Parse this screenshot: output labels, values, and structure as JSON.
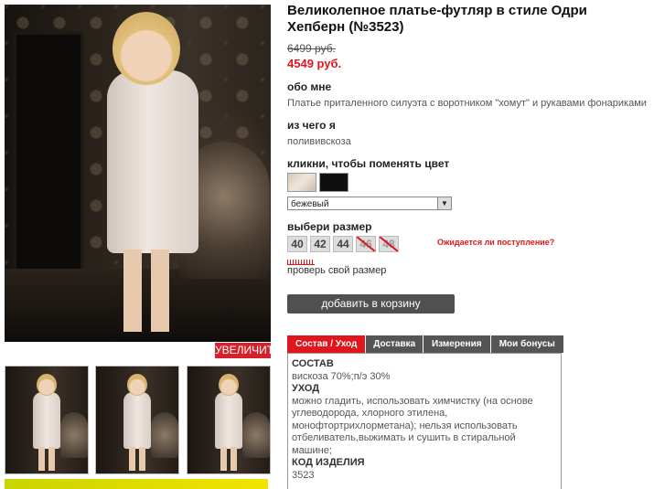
{
  "product": {
    "title": "Великолепное платье-футляр в стиле Одри Хепберн (№3523)",
    "old_price": "6499 руб.",
    "new_price": "4549 руб."
  },
  "gallery": {
    "zoom_label": "УВЕЛИЧИТЬ",
    "thumbnails": [
      "photo-1",
      "photo-2",
      "photo-3"
    ]
  },
  "about": {
    "heading": "обо мне",
    "text": "Платье приталенного силуэта с воротником \"хомут\" и рукавами фонариками"
  },
  "material": {
    "heading": "из чего я",
    "text": "полививскоза"
  },
  "color": {
    "heading": "кликни, чтобы поменять цвет",
    "swatches": [
      "#e4d9cc",
      "#0f0f10"
    ],
    "selected": "бежевый"
  },
  "size": {
    "heading": "выбери размер",
    "options": [
      {
        "label": "40",
        "available": true
      },
      {
        "label": "42",
        "available": true
      },
      {
        "label": "44",
        "available": true
      },
      {
        "label": "46",
        "available": false
      },
      {
        "label": "48",
        "available": false
      }
    ],
    "waiting_link": "Ожидается ли поступление?",
    "check_link": "проверь свой размер"
  },
  "cart": {
    "button": "добавить в корзину"
  },
  "tabs": {
    "items": [
      "Состав / Уход",
      "Доставка",
      "Измерения",
      "Мои бонусы"
    ],
    "active": "Состав / Уход"
  },
  "details": {
    "composition_heading": "СОСТАВ",
    "composition": "вискоза 70%;п/э 30%",
    "care_heading": "УХОД",
    "care": "можно гладить, использовать химчистку (на основе углеводорода, хлорного этилена, монофтортрихлорметана); нельзя использовать отбеливатель,выжимать и сушить в стиральной машине;",
    "code_heading": "КОД ИЗДЕЛИЯ",
    "code": "3523"
  },
  "colors": {
    "accent": "#e0161c",
    "button": "#505050"
  }
}
